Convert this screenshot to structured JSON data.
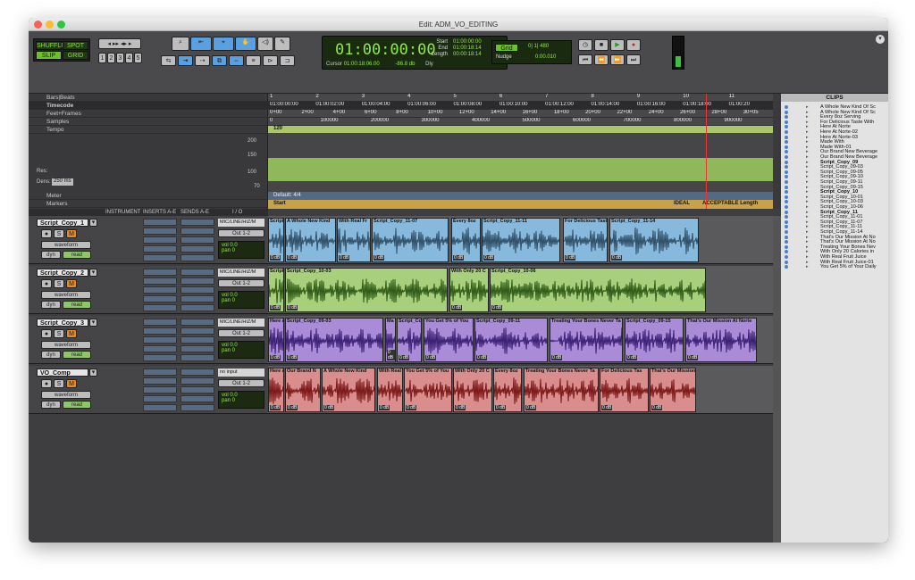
{
  "window_title": "Edit: ADM_VO_EDITING",
  "modes": {
    "shuffle": "SHUFFLE",
    "spot": "SPOT",
    "slip": "SLIP",
    "grid": "GRID"
  },
  "zoom_presets": [
    "1",
    "2",
    "3",
    "4",
    "5"
  ],
  "counter": {
    "main": "01:00:00:00",
    "start_label": "Start",
    "end_label": "End",
    "length_label": "Length",
    "start": "01:00:00:00",
    "end": "01:00:18:14",
    "length": "00:00:18:14",
    "cursor_label": "Cursor",
    "cursor": "01:00:18:06.00",
    "level": "-86.8 db",
    "dly": "Dly"
  },
  "grid": {
    "label": "Grid",
    "value": "0| 1| 480",
    "nudge_label": "Nudge",
    "nudge": "0:00.010"
  },
  "rulers": {
    "rows": [
      "Bars|Beats",
      "Timecode",
      "Feet+Frames",
      "Samples",
      "Tempo"
    ],
    "bars": [
      "1",
      "2",
      "3",
      "4",
      "5",
      "6",
      "7",
      "8",
      "9",
      "10",
      "11"
    ],
    "timecode": [
      "01:00:00:00",
      "01:00:02:00",
      "01:00:04:00",
      "01:00:06:00",
      "01:00:08:00",
      "01:00:10:00",
      "01:00:12:00",
      "01:00:14:00",
      "01:00:16:00",
      "01:00:18:00",
      "01:00:20"
    ],
    "feet": [
      "0+00",
      "2+00",
      "4+00",
      "6+00",
      "8+00",
      "10+00",
      "12+00",
      "14+00",
      "16+00",
      "18+00",
      "20+00",
      "22+00",
      "24+00",
      "26+00",
      "28+00",
      "30+05"
    ],
    "samples": [
      "0",
      "100000",
      "200000",
      "300000",
      "400000",
      "500000",
      "600000",
      "700000",
      "800000",
      "900000"
    ],
    "tempo_value": "120",
    "tempo_scale": [
      "200",
      "150",
      "100",
      "70"
    ],
    "res_label": "Res:",
    "dens_label": "Dens:",
    "dens_value": "250 ms",
    "meter_label": "Meter",
    "meter_value": "Default: 4/4",
    "markers_label": "Markers",
    "marker_start": "Start",
    "ideal": "IDEAL",
    "acceptable": "ACCEPTABLE Length"
  },
  "columns": {
    "instrument": "INSTRUMENT",
    "inserts": "INSERTS A-E",
    "sends": "SENDS A-E",
    "io": "I / O"
  },
  "tracks": [
    {
      "name": "Script_Copy_1",
      "input": "MIC/LINE/HIZ/M",
      "output": "Out 1-2",
      "vol": "0.0",
      "pan": "0",
      "view": "waveform",
      "auto": "read",
      "dyn": "dyn",
      "color": "#86b9dc",
      "wave": "#2f4f66",
      "clips": [
        [
          "Script",
          0,
          18
        ],
        [
          "A Whole New Kind",
          19,
          57
        ],
        [
          "With Real Fr",
          77,
          38
        ],
        [
          "Script_Copy_11-07",
          116,
          86
        ],
        [
          "Every 8oz",
          205,
          33
        ],
        [
          "Script_Copy_11-11",
          239,
          88
        ],
        [
          "For Delicious Tast",
          330,
          50
        ],
        [
          "Script_Copy_11-14",
          382,
          100
        ]
      ]
    },
    {
      "name": "Script_Copy_2",
      "input": "MIC/LINE/HIZ/M",
      "output": "Out 1-2",
      "vol": "0.0",
      "pan": "0",
      "view": "waveform",
      "auto": "read",
      "dyn": "dyn",
      "color": "#a7cf7c",
      "wave": "#2f5a16",
      "clips": [
        [
          "Script",
          0,
          18
        ],
        [
          "Script_Copy_10-03",
          19,
          182
        ],
        [
          "With Only 20 C",
          203,
          44
        ],
        [
          "Script_Copy_10-06",
          248,
          242
        ]
      ]
    },
    {
      "name": "Script_Copy_3",
      "input": "MIC/LINE/HIZ/M",
      "output": "Out 1-2",
      "vol": "0.0",
      "pan": "0",
      "view": "waveform",
      "auto": "read",
      "dyn": "dyn",
      "color": "#a98bd8",
      "wave": "#3b1f73",
      "clips": [
        [
          "Here A",
          0,
          18
        ],
        [
          "Script_Copy_09-03",
          19,
          110
        ],
        [
          "Ma",
          131,
          12
        ],
        [
          "Script_Cc",
          144,
          28
        ],
        [
          "You Get 5% of You",
          174,
          56
        ],
        [
          "Script_Copy_09-11",
          231,
          82
        ],
        [
          "Treating Your Bones Never Ta",
          315,
          82
        ],
        [
          "Script_Copy_09-15",
          399,
          66
        ],
        [
          "That's Our Mission At Norte",
          467,
          80
        ]
      ]
    },
    {
      "name": "VO_Comp",
      "input": "no input",
      "output": "Out 1-2",
      "vol": "0.0",
      "pan": "0",
      "view": "waveform",
      "auto": "read",
      "dyn": "dyn",
      "color": "#d98d8d",
      "wave": "#7a1818",
      "clips": [
        [
          "Here A",
          0,
          18
        ],
        [
          "Our Brand N",
          19,
          40
        ],
        [
          "A Whole New Kind",
          60,
          60
        ],
        [
          "With Real",
          122,
          29
        ],
        [
          "You Get 5% of You",
          152,
          54
        ],
        [
          "With Only 20 C",
          207,
          44
        ],
        [
          "Every 8oz",
          252,
          32
        ],
        [
          "Treating Your Bones Never Ta",
          286,
          84
        ],
        [
          "For Delicious Tas",
          371,
          55
        ],
        [
          "That's Our Mission",
          427,
          52
        ]
      ]
    }
  ],
  "clip_meta": {
    "gain": "0 dB",
    "fade": "0 dB"
  },
  "clips_panel": {
    "title": "CLIPS",
    "items": [
      {
        "t": "A Whole New Kind Of Sc",
        "b": false
      },
      {
        "t": "A Whole New Kind Of Sc",
        "b": false
      },
      {
        "t": "Every 8oz Serving",
        "b": false
      },
      {
        "t": "For Delicious Taste With",
        "b": false
      },
      {
        "t": "Here At Norte",
        "b": false
      },
      {
        "t": "Here At Norte-02",
        "b": false
      },
      {
        "t": "Here At Norte-03",
        "b": false
      },
      {
        "t": "Made With",
        "b": false
      },
      {
        "t": "Made With-01",
        "b": false
      },
      {
        "t": "Our Brand New Beverage",
        "b": false
      },
      {
        "t": "Our Brand New Beverage",
        "b": false
      },
      {
        "t": "Script_Copy_09",
        "b": true
      },
      {
        "t": "Script_Copy_09-03",
        "b": false
      },
      {
        "t": "Script_Copy_09-05",
        "b": false
      },
      {
        "t": "Script_Copy_09-10",
        "b": false
      },
      {
        "t": "Script_Copy_09-11",
        "b": false
      },
      {
        "t": "Script_Copy_09-15",
        "b": false
      },
      {
        "t": "Script_Copy_10",
        "b": true
      },
      {
        "t": "Script_Copy_10-01",
        "b": false
      },
      {
        "t": "Script_Copy_10-03",
        "b": false
      },
      {
        "t": "Script_Copy_10-06",
        "b": false
      },
      {
        "t": "Script_Copy_11",
        "b": true
      },
      {
        "t": "Script_Copy_11-01",
        "b": false
      },
      {
        "t": "Script_Copy_11-07",
        "b": false
      },
      {
        "t": "Script_Copy_11-11",
        "b": false
      },
      {
        "t": "Script_Copy_11-14",
        "b": false
      },
      {
        "t": "That's Our Mission At No",
        "b": false
      },
      {
        "t": "That's Our Mission At No",
        "b": false
      },
      {
        "t": "Treating Your Bones Nev",
        "b": false
      },
      {
        "t": "With Only 20 Calories in",
        "b": false
      },
      {
        "t": "With Real Fruit Juice",
        "b": false
      },
      {
        "t": "With Real Fruit Juice-01",
        "b": false
      },
      {
        "t": "You Get 5% of Your Daily",
        "b": false
      }
    ]
  }
}
